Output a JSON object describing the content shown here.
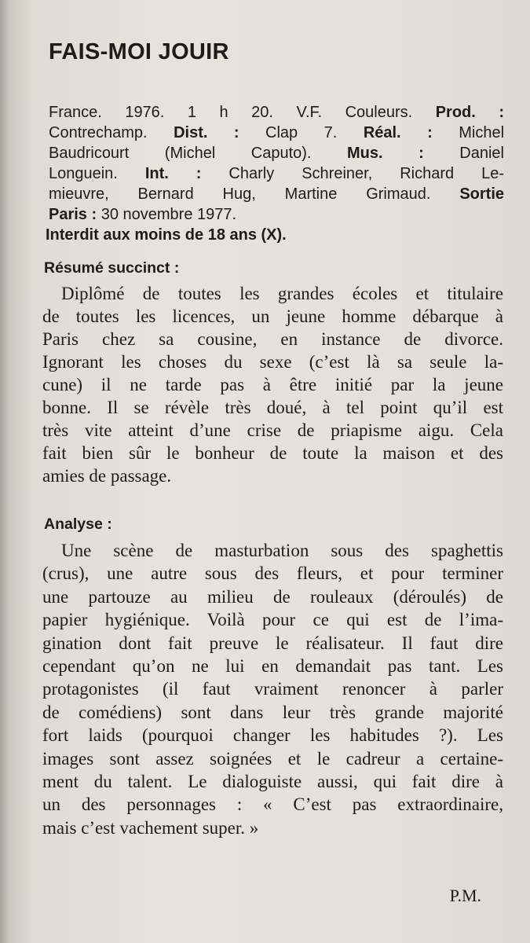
{
  "title": "FAIS-MOI JOUIR",
  "credits_lines": [
    [
      {
        "t": "France. 1976. 1 h 20. V.F. Couleurs. ",
        "b": false
      },
      {
        "t": "Prod. :",
        "b": true
      }
    ],
    [
      {
        "t": "Contrechamp. ",
        "b": false
      },
      {
        "t": "Dist. :",
        "b": true
      },
      {
        "t": " Clap 7. ",
        "b": false
      },
      {
        "t": "Réal. :",
        "b": true
      },
      {
        "t": " Michel",
        "b": false
      }
    ],
    [
      {
        "t": "Baudricourt (Michel Caputo). ",
        "b": false
      },
      {
        "t": "Mus. :",
        "b": true
      },
      {
        "t": " Daniel",
        "b": false
      }
    ],
    [
      {
        "t": "Longuein. ",
        "b": false
      },
      {
        "t": "Int. :",
        "b": true
      },
      {
        "t": " Charly Schreiner, Richard Le-",
        "b": false
      }
    ],
    [
      {
        "t": "mieuvre, Bernard Hug, Martine Grimaud. ",
        "b": false
      },
      {
        "t": "Sortie",
        "b": true
      }
    ],
    [
      {
        "t": "Paris :",
        "b": true
      },
      {
        "t": " 30 novembre 1977.",
        "b": false
      }
    ],
    [
      {
        "t": "Interdit aux moins de 18 ans (X).",
        "b": true
      }
    ]
  ],
  "summary": {
    "heading": "Résumé succinct :",
    "lines": [
      "Diplômé de toutes les grandes écoles et titulaire",
      "de toutes les licences, un jeune homme débarque à",
      "Paris chez sa cousine, en instance de divorce.",
      "Ignorant les choses du sexe (c’est là sa seule la-",
      "cune) il ne tarde pas à être initié par la jeune",
      "bonne. Il se révèle très doué, à tel point qu’il est",
      "très vite atteint d’une crise de priapisme aigu. Cela",
      "fait bien sûr le bonheur de toute la maison et des",
      "amies de passage."
    ]
  },
  "analysis": {
    "heading": "Analyse :",
    "lines": [
      "Une scène de masturbation sous des spaghettis",
      "(crus), une autre sous des fleurs, et pour terminer",
      "une partouze au milieu de rouleaux (déroulés) de",
      "papier hygiénique. Voilà pour ce qui est de l’ima-",
      "gination dont fait preuve le réalisateur. Il faut dire",
      "cependant qu’on ne lui en demandait pas tant. Les",
      "protagonistes (il faut vraiment renoncer à parler",
      "de comédiens) sont dans leur très grande majorité",
      "fort laids (pourquoi changer les habitudes ?). Les",
      "images sont assez soignées et le cadreur a certaine-",
      "ment du talent. Le dialoguiste aussi, qui fait dire à",
      "un des personnages : « C’est pas extraordinaire,",
      "mais c’est vachement super. »"
    ]
  },
  "signature": "P.M."
}
